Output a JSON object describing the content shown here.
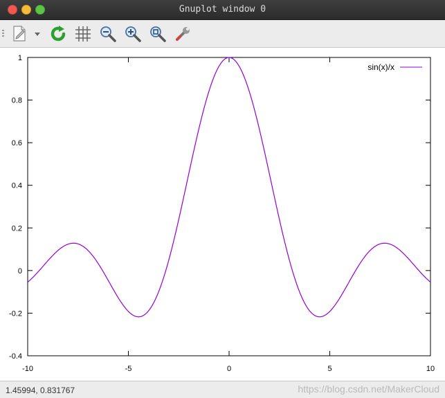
{
  "window": {
    "title": "Gnuplot window 0"
  },
  "toolbar": {
    "icons": [
      "copy-clipboard-icon",
      "dropdown-arrow-icon",
      "replot-icon",
      "grid-icon",
      "zoom-out-icon",
      "zoom-in-icon",
      "zoom-fit-icon",
      "config-wrench-icon"
    ]
  },
  "status": {
    "coords": "1.45994, 0.831767",
    "watermark": "https://blog.csdn.net/MakerCloud"
  },
  "colors": {
    "series": "#9400d3",
    "titlebar": "#333333"
  },
  "chart_data": {
    "type": "line",
    "series": [
      {
        "name": "sin(x)/x",
        "function": "sin(x)/x",
        "x": [
          -10,
          -9.5,
          -9,
          -8.5,
          -8,
          -7.5,
          -7,
          -6.5,
          -6,
          -5.5,
          -5,
          -4.5,
          -4,
          -3.5,
          -3,
          -2.5,
          -2,
          -1.5,
          -1,
          -0.5,
          0,
          0.5,
          1,
          1.5,
          2,
          2.5,
          3,
          3.5,
          4,
          4.5,
          5,
          5.5,
          6,
          6.5,
          7,
          7.5,
          8,
          8.5,
          9,
          9.5,
          10
        ],
        "y": [
          -0.0544,
          -0.0792,
          0.0458,
          0.0938,
          0.1237,
          0.125,
          0.0939,
          0.033,
          -0.0466,
          -0.1282,
          -0.1918,
          -0.2172,
          -0.1892,
          -0.1002,
          0.047,
          0.2394,
          0.4546,
          0.665,
          0.8415,
          0.9589,
          1.0,
          0.9589,
          0.8415,
          0.665,
          0.4546,
          0.2394,
          0.047,
          -0.1002,
          -0.1892,
          -0.2172,
          -0.1918,
          -0.1282,
          -0.0466,
          0.033,
          0.0939,
          0.125,
          0.1237,
          0.0938,
          0.0458,
          -0.0792,
          -0.0544
        ]
      }
    ],
    "xlim": [
      -10,
      10
    ],
    "ylim": [
      -0.4,
      1
    ],
    "xticks": [
      -10,
      -5,
      0,
      5,
      10
    ],
    "yticks": [
      -0.4,
      -0.2,
      0,
      0.2,
      0.4,
      0.6,
      0.8,
      1
    ],
    "xtick_labels": [
      "-10",
      "-5",
      "0",
      "5",
      "10"
    ],
    "ytick_labels": [
      "-0.4",
      "-0.2",
      "0",
      "0.2",
      "0.4",
      "0.6",
      "0.8",
      "1"
    ],
    "legend_position": "top-right",
    "grid": false
  }
}
